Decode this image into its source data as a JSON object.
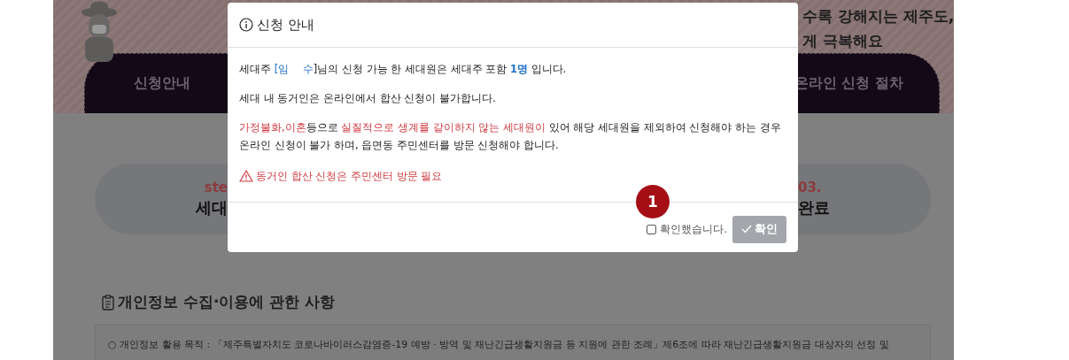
{
  "banner": {
    "headline_lines": [
      "수록 강해지는 제주도,",
      "게 극복해요"
    ],
    "tabs": [
      {
        "label": "신청안내"
      },
      {
        "label": "온라인 신청 절차"
      }
    ]
  },
  "steps": [
    {
      "number": "ste",
      "title": "세대"
    },
    {
      "number": "03.",
      "title": "완료"
    }
  ],
  "section": {
    "title": "개인정보 수집·이용에 관한 사항",
    "text": "○ 개인정보 활용 목적 : 「제주특별자치도 코로나바이러스감염증-19 예방 · 방역 및 재난긴급생활지원금 등 지원에 관한 조례」제6조에 따라 재난긴급생활지원금 대상자의 선정 및"
  },
  "modal": {
    "title": "신청 안내",
    "paragraphs": [
      {
        "kind": "text",
        "segments": [
          {
            "kind": "plain",
            "text": "세대주 "
          },
          {
            "kind": "name",
            "text": "[임　 수"
          },
          {
            "kind": "plain",
            "text": "]님의 신청 가능 한 세대원은 세대주 포함 "
          },
          {
            "kind": "count",
            "text": "1명"
          },
          {
            "kind": "plain",
            "text": " 입니다."
          }
        ]
      },
      {
        "kind": "text",
        "segments": [
          {
            "kind": "plain",
            "text": "세대 내 동거인은 온라인에서 합산 신청이 불가합니다."
          }
        ]
      },
      {
        "kind": "text",
        "segments": [
          {
            "kind": "alert",
            "text": "가정불화,이혼"
          },
          {
            "kind": "plain",
            "text": "등으로 "
          },
          {
            "kind": "alert",
            "text": "실질적으로 생계를 같이하지 않는 세대원이"
          },
          {
            "kind": "plain",
            "text": " 있어 해당 세대원을 제외하여 신청해야 하는 경우 온라인 신청이 불가 하며, 읍면동 주민센터를 방문 신청해야 합니다."
          }
        ]
      },
      {
        "kind": "warning",
        "segments": [
          {
            "kind": "alert",
            "text": "동거인 합산 신청은 주민센터 방문 필요"
          }
        ]
      }
    ],
    "confirm_checkbox": {
      "label": "확인했습니다.",
      "checked": false
    },
    "confirm_button": {
      "label": "확인",
      "disabled": true
    },
    "badge": "1"
  }
}
